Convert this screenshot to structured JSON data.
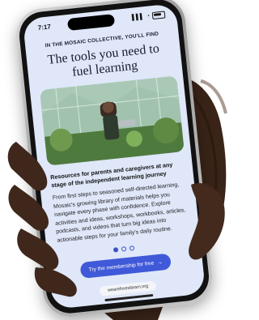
{
  "status_bar": {
    "time": "7:17",
    "signal": "▌▌▌",
    "wifi": "◔"
  },
  "page": {
    "eyebrow": "IN THE MOSAIC COLLECTIVE, YOU'LL FIND",
    "headline": "The tools you need to fuel learning",
    "subhead": "Resources for parents and caregivers at any stage of the independent learning journey",
    "body": "From first steps to seasoned self-directed learning, Mosaic's growing library of materials helps you navigate every phase with confidence. Explore activities and ideas, workshops, workbooks, articles, podcasts, and videos that turn big ideas into actionable steps for your family's daily routine.",
    "carousel": {
      "active_index": 0,
      "count": 3
    },
    "cta_label": "Try the membership for free",
    "cta_arrow": "→"
  },
  "browser": {
    "url": "weareforestlearn.org"
  },
  "colors": {
    "screen_bg": "#dfe7f9",
    "accent": "#3f59d8"
  }
}
